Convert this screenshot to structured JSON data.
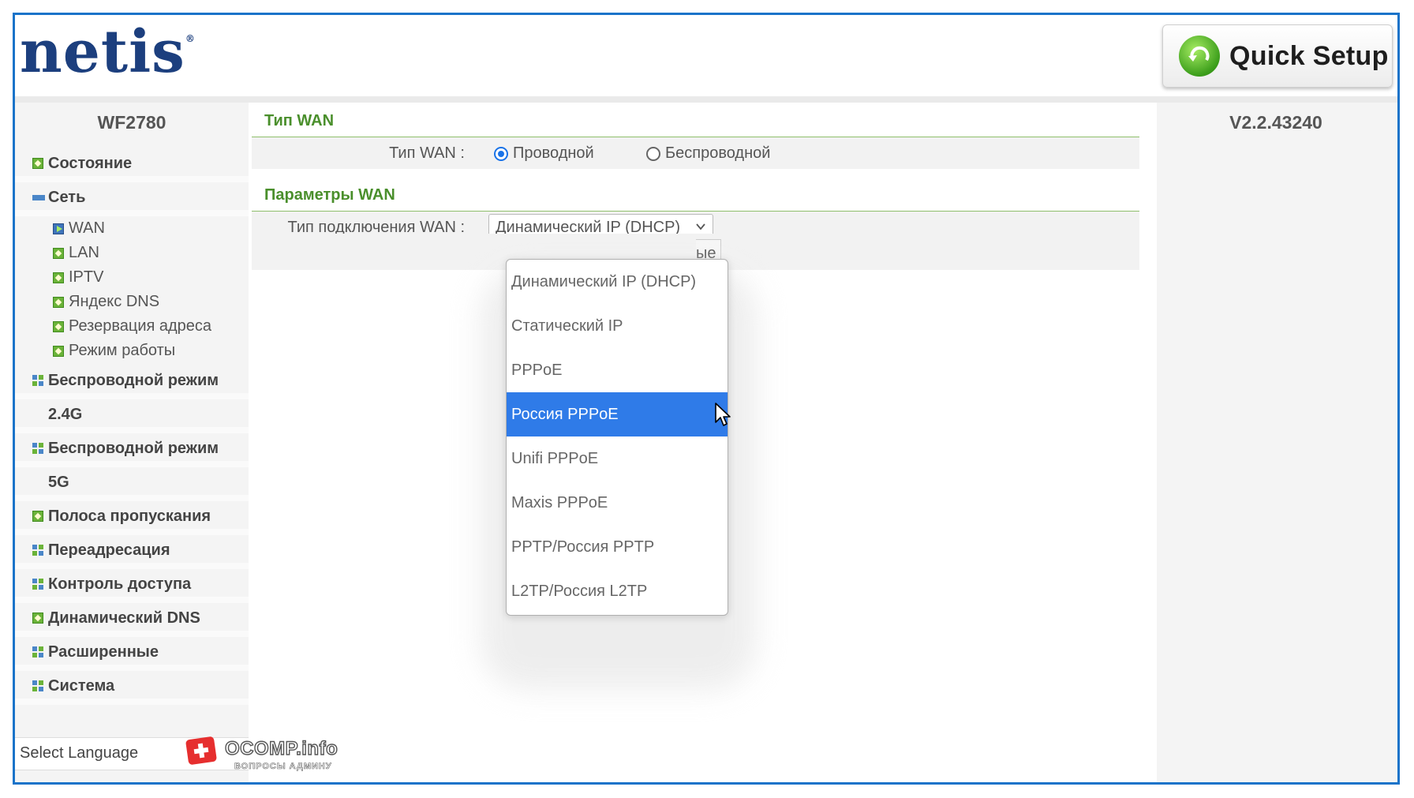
{
  "header": {
    "logo": "netis",
    "quick_setup": "Quick Setup"
  },
  "sidebar": {
    "model": "WF2780",
    "menu": [
      {
        "label": "Состояние",
        "icon": "status-icon"
      },
      {
        "label": "Сеть",
        "icon": "collapse-icon"
      },
      {
        "label": "WAN",
        "icon": "arrow-icon"
      },
      {
        "label": "LAN",
        "icon": "bullet-icon"
      },
      {
        "label": "IPTV",
        "icon": "bullet-icon"
      },
      {
        "label": "Яндекс DNS",
        "icon": "bullet-icon"
      },
      {
        "label": "Резервация адреса",
        "icon": "bullet-icon"
      },
      {
        "label": "Режим работы",
        "icon": "bullet-icon"
      },
      {
        "label": "Беспроводной режим",
        "icon": "grid-icon"
      },
      {
        "label": "2.4G"
      },
      {
        "label": "Беспроводной режим",
        "icon": "grid-icon"
      },
      {
        "label": "5G"
      },
      {
        "label": "Полоса пропускания",
        "icon": "bullet-icon"
      },
      {
        "label": "Переадресация",
        "icon": "grid-icon"
      },
      {
        "label": "Контроль доступа",
        "icon": "grid-icon"
      },
      {
        "label": "Динамический DNS",
        "icon": "bullet-icon"
      },
      {
        "label": "Расширенные",
        "icon": "grid-icon"
      },
      {
        "label": "Система",
        "icon": "grid-icon"
      }
    ],
    "language": "Select Language"
  },
  "version": "V2.2.43240",
  "wan_type": {
    "section_title": "Тип WAN",
    "label": "Тип WAN :",
    "options": [
      "Проводной",
      "Беспроводной"
    ],
    "selected": "Проводной"
  },
  "wan_params": {
    "section_title": "Параметры WAN",
    "connection_label": "Тип подключения WAN :",
    "connection_value": "Динамический IP (DHCP)",
    "hidden_button_tail": "ые"
  },
  "dropdown": {
    "options": [
      "Динамический IP (DHCP)",
      "Статический IP",
      "PPPoE",
      "Россия PPPoE",
      "Unifi PPPoE",
      "Maxis PPPoE",
      "PPTP/Россия PPTP",
      "L2TP/Россия L2TP"
    ],
    "highlighted": "Россия PPPoE"
  },
  "watermark": {
    "title": "OCOMP.info",
    "subtitle": "ВОПРОСЫ АДМИНУ"
  },
  "colors": {
    "frame": "#1a73c9",
    "logo": "#1c3f7e",
    "section_green": "#4a8f2c",
    "highlight": "#2f7be8"
  }
}
